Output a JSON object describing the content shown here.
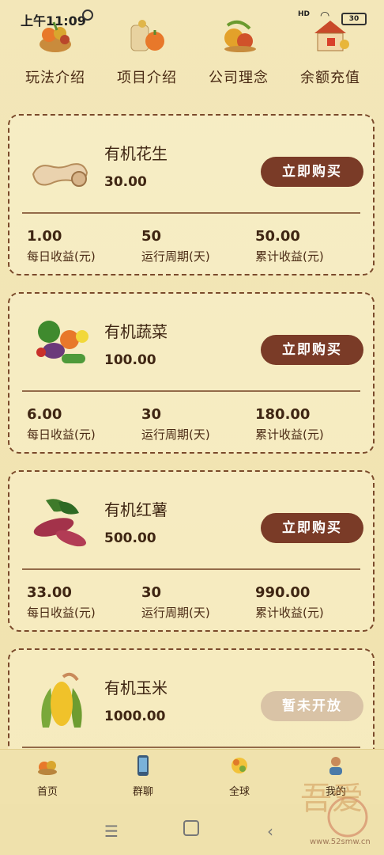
{
  "status_bar": {
    "time": "上午11:09",
    "network": "HD",
    "battery": "30"
  },
  "top_nav": [
    {
      "label": "玩法介绍",
      "icon": "basket-icon"
    },
    {
      "label": "项目介绍",
      "icon": "grain-sack-icon"
    },
    {
      "label": "公司理念",
      "icon": "harvest-icon"
    },
    {
      "label": "余额充值",
      "icon": "house-icon"
    }
  ],
  "products": [
    {
      "name": "有机花生",
      "price": "30.00",
      "button": "立即购买",
      "enabled": true,
      "daily": "1.00",
      "daily_label": "每日收益(元)",
      "period": "50",
      "period_label": "运行周期(天)",
      "total": "50.00",
      "total_label": "累计收益(元)"
    },
    {
      "name": "有机蔬菜",
      "price": "100.00",
      "button": "立即购买",
      "enabled": true,
      "daily": "6.00",
      "daily_label": "每日收益(元)",
      "period": "30",
      "period_label": "运行周期(天)",
      "total": "180.00",
      "total_label": "累计收益(元)"
    },
    {
      "name": "有机红薯",
      "price": "500.00",
      "button": "立即购买",
      "enabled": true,
      "daily": "33.00",
      "daily_label": "每日收益(元)",
      "period": "30",
      "period_label": "运行周期(天)",
      "total": "990.00",
      "total_label": "累计收益(元)"
    },
    {
      "name": "有机玉米",
      "price": "1000.00",
      "button": "暂未开放",
      "enabled": false
    }
  ],
  "tab_bar": [
    {
      "label": "首页"
    },
    {
      "label": "群聊"
    },
    {
      "label": "全球"
    },
    {
      "label": "我的"
    }
  ],
  "watermark": "www.52smw.cn",
  "colors": {
    "accent": "#7a3b27",
    "disabled": "#d9c3a6",
    "background": "#f3e7b9"
  }
}
